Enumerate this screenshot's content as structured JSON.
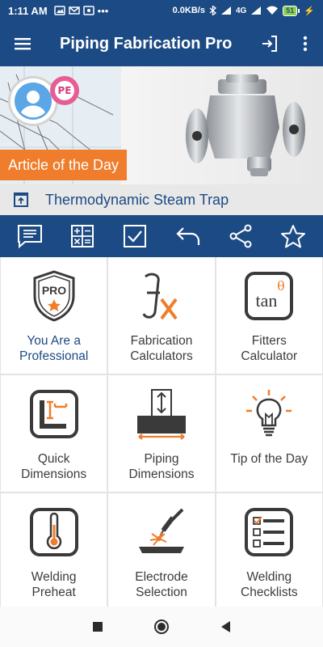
{
  "status": {
    "time": "1:11 AM",
    "speed": "0.0KB/s",
    "network": "4G",
    "battery": "51"
  },
  "app_bar": {
    "title": "Piping Fabrication Pro"
  },
  "banner": {
    "badge_text": "PE",
    "tag": "Article of the Day"
  },
  "article": {
    "title": "Thermodynamic Steam Trap"
  },
  "toolbar": {
    "items": [
      "comment-icon",
      "calculator-icon",
      "checkbox-icon",
      "undo-icon",
      "share-icon",
      "star-icon"
    ]
  },
  "tiles": [
    {
      "label": "You Are a\nProfessional",
      "icon": "pro-shield-icon",
      "pro_text": "PRO"
    },
    {
      "label": "Fabrication\nCalculators",
      "icon": "function-icon"
    },
    {
      "label": "Fitters\nCalculator",
      "icon": "tan-theta-icon",
      "icon_text": "tan",
      "theta": "θ"
    },
    {
      "label": "Quick\nDimensions",
      "icon": "quick-dimensions-icon"
    },
    {
      "label": "Piping\nDimensions",
      "icon": "piping-dimensions-icon"
    },
    {
      "label": "Tip of the Day",
      "icon": "lightbulb-icon"
    },
    {
      "label": "Welding\nPreheat",
      "icon": "thermometer-icon"
    },
    {
      "label": "Electrode\nSelection",
      "icon": "welding-torch-icon"
    },
    {
      "label": "Welding\nChecklists",
      "icon": "checklist-icon"
    }
  ],
  "colors": {
    "primary": "#1c4a84",
    "accent": "#ef7d2c",
    "icon_gray": "#3a3a3a"
  }
}
